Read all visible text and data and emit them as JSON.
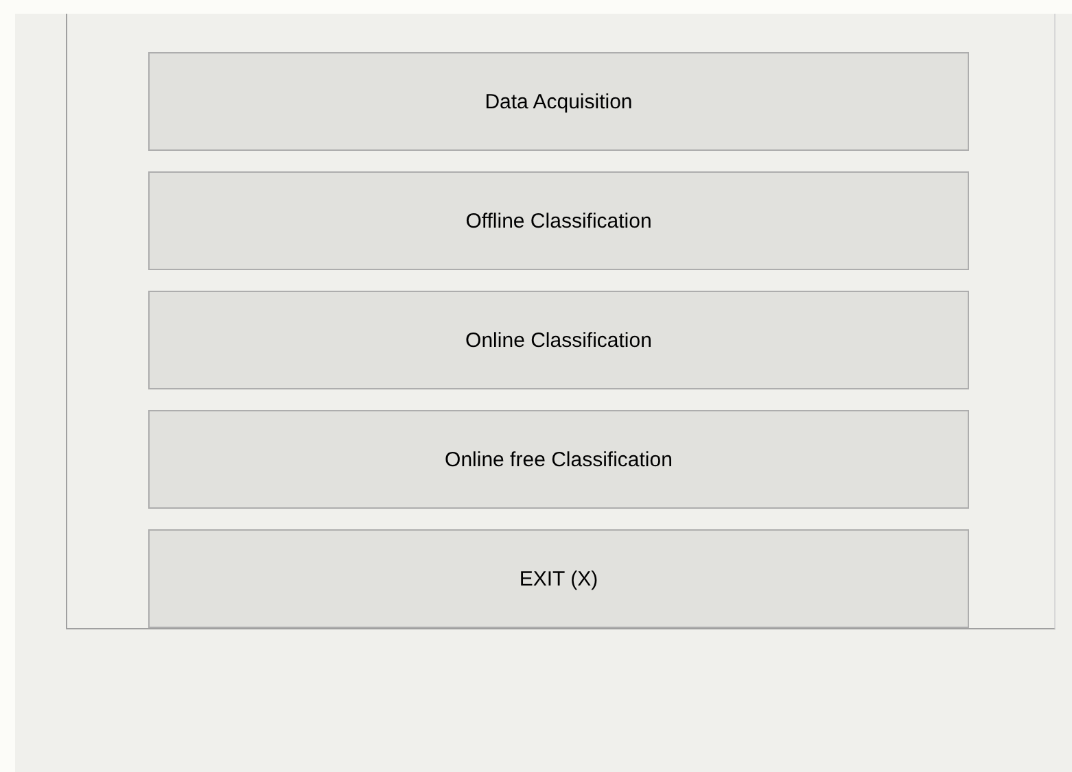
{
  "panel": {
    "buttons": [
      {
        "label": "Data Acquisition"
      },
      {
        "label": "Offline Classification"
      },
      {
        "label": "Online Classification"
      },
      {
        "label": "Online free Classification"
      },
      {
        "label": "EXIT (X)"
      }
    ]
  }
}
